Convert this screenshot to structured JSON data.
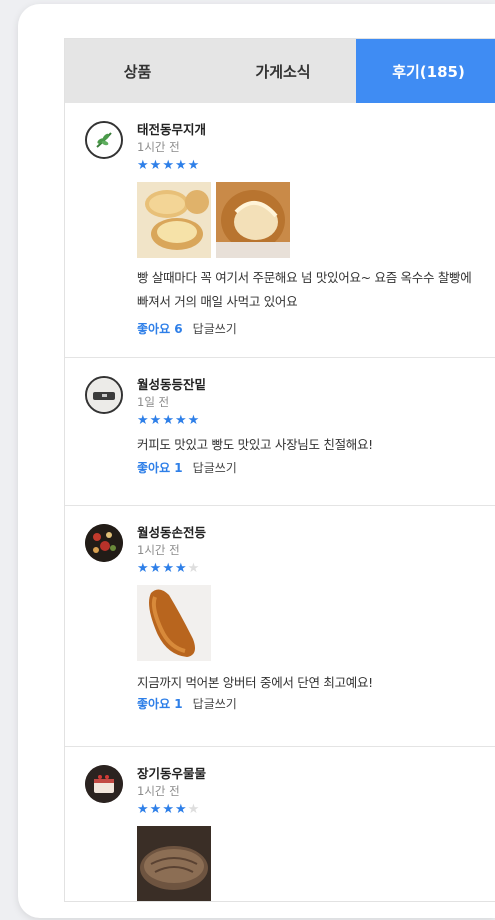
{
  "tabs": [
    {
      "label": "상품"
    },
    {
      "label": "가게소식"
    },
    {
      "label": "후기(185)"
    }
  ],
  "reviews": [
    {
      "name": "태전동무지개",
      "time": "1시간 전",
      "rating": 5,
      "text": "빵 살때마다 꼭 여기서 주문해요 넘 맛있어요~ 요즘 옥수수 찰빵에 빠져서 거의 매일 사먹고 있어요",
      "like": "좋아요 6",
      "reply": "답글쓰기"
    },
    {
      "name": "월성동등잔밑",
      "time": "1일 전",
      "rating": 5,
      "text": "커피도 맛있고 빵도 맛있고 사장님도 친절해요!",
      "like": "좋아요 1",
      "reply": "답글쓰기"
    },
    {
      "name": "월성동손전등",
      "time": "1시간 전",
      "rating": 4,
      "text": "지금까지 먹어본 앙버터 중에서 단연 최고예요!",
      "like": "좋아요 1",
      "reply": "답글쓰기"
    },
    {
      "name": "장기동우물물",
      "time": "1시간 전",
      "rating": 4,
      "text": "",
      "like": "",
      "reply": ""
    }
  ],
  "colors": {
    "accent": "#3f8cf3",
    "star": "#2e7fe8"
  }
}
